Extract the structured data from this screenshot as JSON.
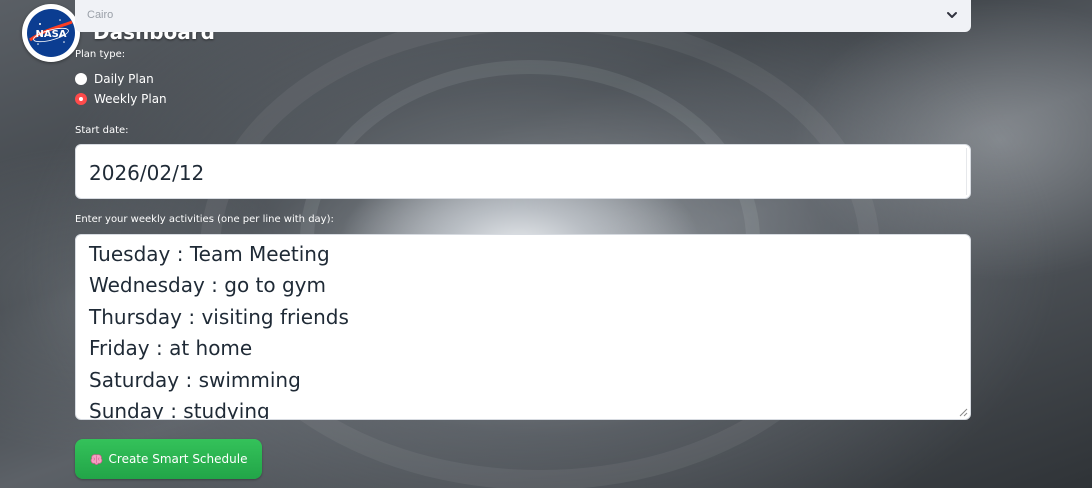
{
  "app": {
    "logo": "NASA",
    "title": "Dashboard"
  },
  "location_select": {
    "value": "Cairo",
    "icon": "chevron-down-icon"
  },
  "plan_type": {
    "label": "Plan type:",
    "options": [
      {
        "label": "Daily Plan",
        "checked": false
      },
      {
        "label": "Weekly Plan",
        "checked": true
      }
    ]
  },
  "start_date": {
    "label": "Start date:",
    "value": "2026/02/12"
  },
  "activities": {
    "label": "Enter your weekly activities (one per line with day):",
    "lines": [
      "Tuesday : Team Meeting",
      "Wednesday : go to gym",
      "Thursday : visiting friends",
      "Friday : at home",
      "Saturday : swimming",
      "Sunday : studying"
    ]
  },
  "create_button": {
    "label": "Create Smart Schedule",
    "icon": "brain-icon",
    "color": "#2db553"
  },
  "colors": {
    "accent_radio": "#ff4b4b",
    "input_bg": "#ffffff",
    "select_bg": "#f0f2f6"
  }
}
